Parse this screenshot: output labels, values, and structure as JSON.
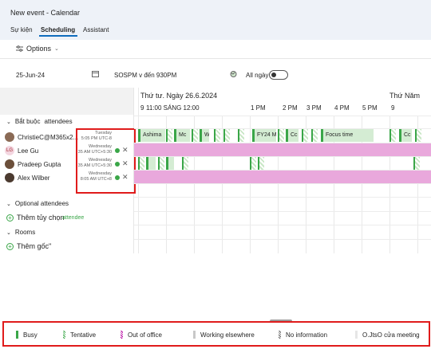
{
  "window": {
    "title": "New event - Calendar"
  },
  "tabs": [
    {
      "label": "Sự kiện"
    },
    {
      "label": "Scheduling"
    },
    {
      "label": "Assistant"
    }
  ],
  "toolbar": {
    "options_label": "Options"
  },
  "datebar": {
    "date": "25-Jun-24",
    "time_range": "SOSPM v đến 930PM",
    "all_day_label": "All ngày",
    "all_day_on": false
  },
  "grid": {
    "day1_label": "Thứ tư. Ngày 26.6.2024",
    "day2_label": "Thứ Năm",
    "hours": [
      "9",
      "11:00 SÁNG 12:00",
      "1 PM",
      "2 PM",
      "3 PM",
      "4 PM",
      "5 PM",
      "9"
    ]
  },
  "attendees": {
    "required_label": "Bắt buộc",
    "required_suffix": "attendees",
    "people": [
      {
        "name": "ChristieC@M365x2...",
        "initials": "",
        "day": "Tuesday",
        "time": "5:05 PM UTC-8"
      },
      {
        "name": "Lee Gu",
        "initials": "LG",
        "day": "Wednesday",
        "time": "35 AM UTC+5:30"
      },
      {
        "name": "Pradeep Gupta",
        "initials": "",
        "day": "Wednesday",
        "time": "35 AM UTC+5:30"
      },
      {
        "name": "Alex Wilber",
        "initials": "",
        "day": "Wednesday",
        "time": "8:05 AM UTC+8"
      }
    ],
    "optional_label": "Optional attendees",
    "add_optional": "Thêm tủy chọn",
    "add_optional_overlay": "attendee",
    "rooms_label": "Rooms",
    "add_room": "Thêm gốc\""
  },
  "events": {
    "row1": [
      "Ashima",
      "Mc",
      "W",
      "FY24 M",
      "Cc",
      "Focus time",
      "Cc"
    ]
  },
  "legend": {
    "items": [
      {
        "label": "Busy",
        "color": "#3aa648"
      },
      {
        "label": "Tentative",
        "color": "#3aa648"
      },
      {
        "label": "Out of office",
        "color": "#b4009e"
      },
      {
        "label": "Working elsewhere",
        "color": "#c8c8c8"
      },
      {
        "label": "No information",
        "color": "#616161"
      },
      {
        "label": "O.JtsO cửa meeting",
        "color": "#e6e6e6"
      }
    ]
  }
}
